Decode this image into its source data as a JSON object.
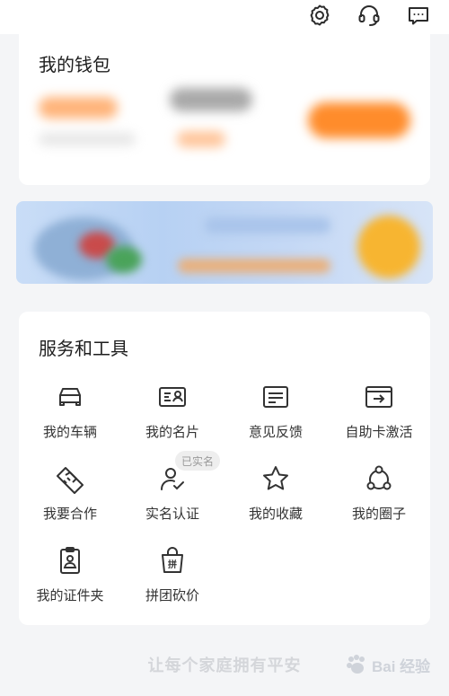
{
  "header": {
    "icons": [
      "settings-icon",
      "customer-service-icon",
      "message-icon"
    ]
  },
  "wallet": {
    "title": "我的钱包"
  },
  "services": {
    "title": "服务和工具",
    "items": [
      {
        "label": "我的车辆",
        "icon": "car-icon"
      },
      {
        "label": "我的名片",
        "icon": "business-card-icon"
      },
      {
        "label": "意见反馈",
        "icon": "feedback-icon"
      },
      {
        "label": "自助卡激活",
        "icon": "card-activate-icon"
      },
      {
        "label": "我要合作",
        "icon": "handshake-icon"
      },
      {
        "label": "实名认证",
        "icon": "verify-user-icon"
      },
      {
        "label": "我的收藏",
        "icon": "star-icon"
      },
      {
        "label": "我的圈子",
        "icon": "circle-group-icon"
      },
      {
        "label": "我的证件夹",
        "icon": "id-folder-icon"
      },
      {
        "label": "拼团砍价",
        "icon": "group-buy-bag-icon"
      }
    ],
    "verified_badge": "已实名"
  },
  "footer": {
    "slogan": "让每个家庭拥有平安",
    "watermark": "Bai 经验"
  },
  "colors": {
    "accent_orange": "#ff8c2b",
    "annotation_arrow": "#e0201c",
    "icon_stroke": "#333333"
  }
}
